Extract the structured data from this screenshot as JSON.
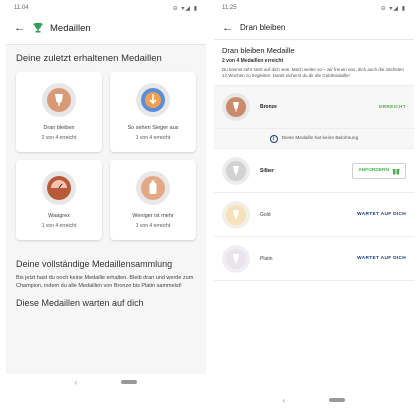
{
  "left": {
    "status": {
      "time": "11:04",
      "system": "⊖ ▾◢ ▮"
    },
    "appbar": {
      "title": "Medaillen"
    },
    "recent": {
      "title": "Deine zuletzt erhaltenen Medaillen",
      "cards": [
        {
          "name": "Dran bleiben",
          "progress": "2 von 4 erreicht",
          "icon": "wine-glass-medal-icon"
        },
        {
          "name": "So sehen Sieger aus",
          "progress": "1 von 4 erreicht",
          "icon": "thumbs-up-medal-icon"
        },
        {
          "name": "Waagrex",
          "progress": "1 von 4 erreicht",
          "icon": "scale-medal-icon"
        },
        {
          "name": "Weniger ist mehr",
          "progress": "1 von 4 erreicht",
          "icon": "bottle-medal-icon"
        }
      ]
    },
    "collection": {
      "title": "Deine vollständige Medaillensammlung",
      "desc": "Bis jetzt hast du noch keine Medaille erhalten. Bleib dran und werde zum Champion, indem du alle Medaillen von Bronze bis Platin sammelst!"
    },
    "waiting_title": "Diese Medaillen warten auf dich"
  },
  "right": {
    "status": {
      "time": "11:25",
      "system": "⊖ ▾◢ ▮"
    },
    "appbar": {
      "title": "Dran bleiben"
    },
    "intro": {
      "title": "Dran bleiben Medaille",
      "progress": "2 von 4 Medaillen erreicht",
      "desc": "Du kannst sehr stolz auf dich sein. Mach weiter so – wir freuen uns, dich auch die nächsten 12 Wochen zu begleiten. Damit sicherst du dir die Goldmedaille!"
    },
    "medals": [
      {
        "name": "Bronze",
        "status": "ERREICHT"
      },
      {
        "name": "Silber",
        "status": "ANFORDERN"
      },
      {
        "name": "Gold",
        "status": "WARTET AUF DICH"
      },
      {
        "name": "Platin",
        "status": "WARTET AUF DICH"
      }
    ],
    "info": "Diese Medaille hat keine Belohnung"
  },
  "colors": {
    "accent_green": "#4caf50",
    "accent_navy": "#1a3a7a",
    "bronze": "#c98b6b"
  }
}
